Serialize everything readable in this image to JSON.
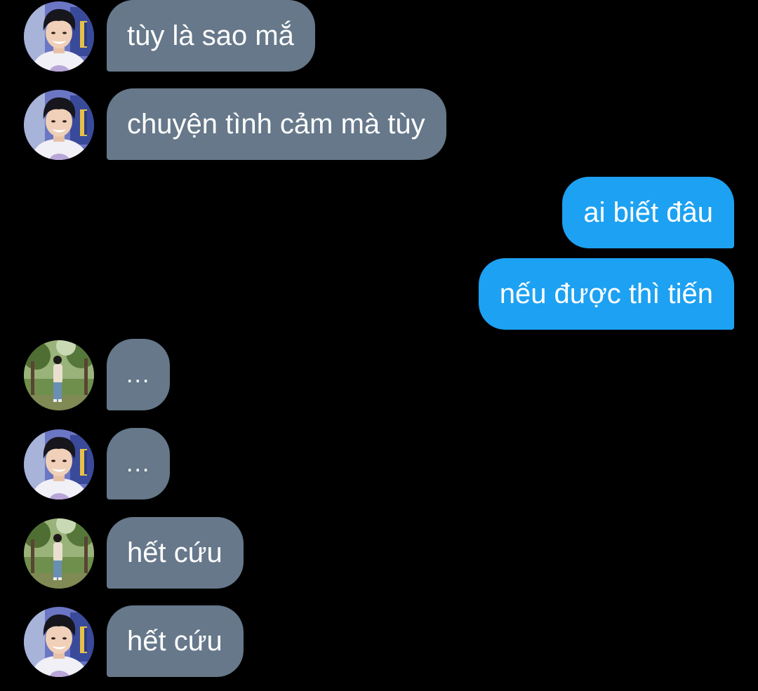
{
  "colors": {
    "background": "#000000",
    "incoming_bubble": "#66788a",
    "outgoing_bubble": "#1da1f2",
    "text": "#ffffff"
  },
  "messages": [
    {
      "direction": "incoming",
      "avatar": "portrait-avatar",
      "text": "tùy là sao mắ"
    },
    {
      "direction": "incoming",
      "avatar": "portrait-avatar",
      "text": "chuyện tình cảm mà tùy"
    },
    {
      "direction": "outgoing",
      "text": "ai biết đâu"
    },
    {
      "direction": "outgoing",
      "text": "nếu được thì tiến"
    },
    {
      "direction": "incoming",
      "avatar": "park-avatar",
      "text": "..."
    },
    {
      "direction": "incoming",
      "avatar": "portrait-avatar",
      "text": "..."
    },
    {
      "direction": "incoming",
      "avatar": "park-avatar",
      "text": "hết cứu"
    },
    {
      "direction": "incoming",
      "avatar": "portrait-avatar",
      "text": "hết cứu"
    }
  ]
}
